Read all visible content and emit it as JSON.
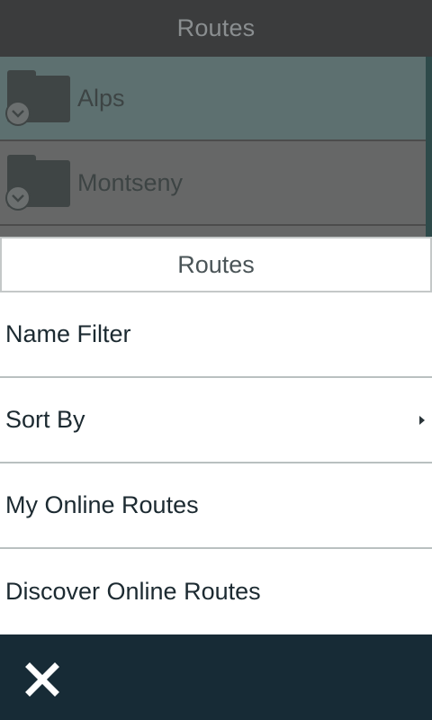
{
  "app": {
    "title": "Routes",
    "folders": [
      {
        "label": "Alps",
        "icon": "folder-icon",
        "state": "selected"
      },
      {
        "label": "Montseny",
        "icon": "folder-icon"
      }
    ]
  },
  "menu": {
    "title": "Routes",
    "items": [
      {
        "label": "Name Filter"
      },
      {
        "label": "Sort By",
        "has_submenu": true,
        "icon": "submenu-arrow-icon"
      },
      {
        "label": "My Online Routes"
      },
      {
        "label": "Discover Online Routes"
      }
    ]
  },
  "bottom_bar": {
    "close_icon": "close-icon"
  },
  "colors": {
    "header_bg": "#3b3c3d",
    "selected_row": "#5d7070",
    "row_bg": "#666767",
    "bottom_bar_bg": "#172b36",
    "menu_text": "#1c2a31",
    "divider": "#b9c0c0"
  }
}
